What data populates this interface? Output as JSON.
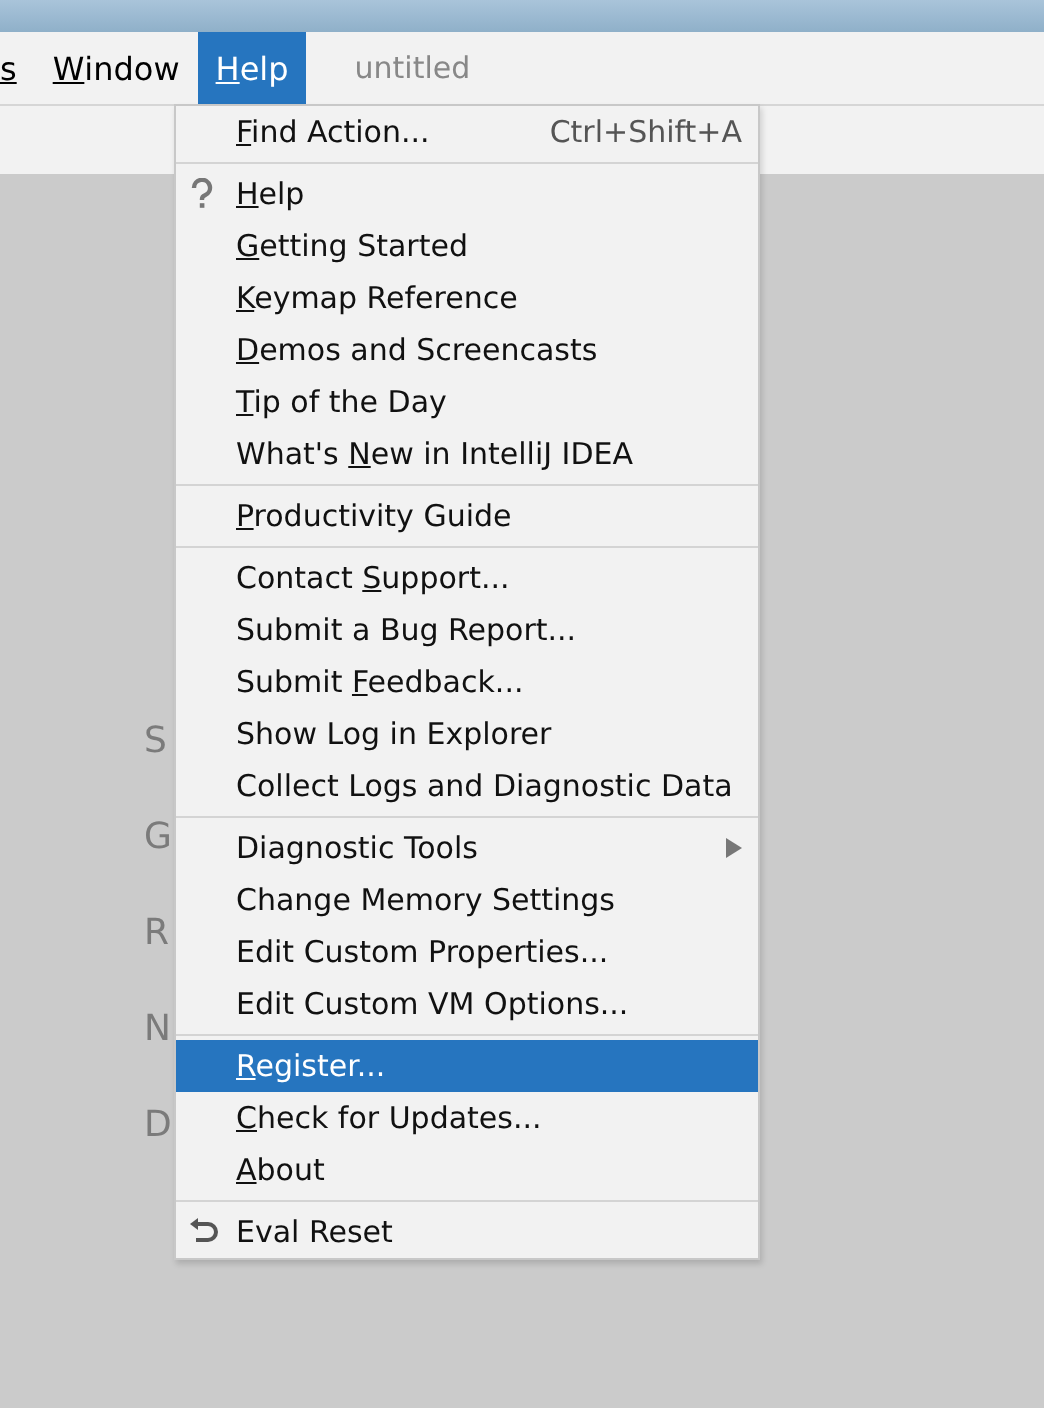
{
  "menubar": {
    "items": [
      {
        "underlined": "s",
        "selected": false
      },
      {
        "underlined": "W",
        "after": "indow",
        "selected": false
      },
      {
        "underlined": "H",
        "after": "elp",
        "selected": true
      }
    ],
    "project": "untitled"
  },
  "background_labels": [
    "S",
    "G",
    "R",
    "N",
    "D"
  ],
  "help_menu": {
    "groups": [
      [
        {
          "kind": "plain",
          "underlined": "F",
          "after": "ind Action...",
          "shortcut": "Ctrl+Shift+A",
          "selected": false
        }
      ],
      [
        {
          "kind": "question",
          "underlined": "H",
          "after": "elp",
          "selected": false
        },
        {
          "kind": "plain",
          "underlined": "G",
          "after": "etting Started",
          "selected": false
        },
        {
          "kind": "plain",
          "underlined": "K",
          "after": "eymap Reference",
          "selected": false
        },
        {
          "kind": "plain",
          "underlined": "D",
          "after": "emos and Screencasts",
          "selected": false
        },
        {
          "kind": "plain",
          "underlined": "T",
          "after": "ip of the Day",
          "selected": false
        },
        {
          "kind": "plain",
          "before": "What's ",
          "underlined": "N",
          "after": "ew in IntelliJ IDEA",
          "selected": false
        }
      ],
      [
        {
          "kind": "plain",
          "underlined": "P",
          "after": "roductivity Guide",
          "selected": false
        }
      ],
      [
        {
          "kind": "plain",
          "before": "Contact ",
          "underlined": "S",
          "after": "upport...",
          "selected": false
        },
        {
          "kind": "plain",
          "before": "Submit a Bug Report...",
          "selected": false
        },
        {
          "kind": "plain",
          "before": "Submit ",
          "underlined": "F",
          "after": "eedback...",
          "selected": false
        },
        {
          "kind": "plain",
          "before": "Show Log in Explorer",
          "selected": false
        },
        {
          "kind": "plain",
          "before": "Collect Logs and Diagnostic Data",
          "selected": false
        }
      ],
      [
        {
          "kind": "submenu",
          "before": "Diagnostic Tools",
          "selected": false
        },
        {
          "kind": "plain",
          "before": "Change Memory Settings",
          "selected": false
        },
        {
          "kind": "plain",
          "before": "Edit Custom Properties...",
          "selected": false
        },
        {
          "kind": "plain",
          "before": "Edit Custom VM Options...",
          "selected": false
        }
      ],
      [
        {
          "kind": "plain",
          "underlined": "R",
          "after": "egister...",
          "selected": true
        },
        {
          "kind": "plain",
          "underlined": "C",
          "after": "heck for Updates...",
          "selected": false
        },
        {
          "kind": "plain",
          "underlined": "A",
          "after": "bout",
          "selected": false
        }
      ],
      [
        {
          "kind": "undo",
          "before": "Eval Reset",
          "selected": false
        }
      ]
    ]
  }
}
